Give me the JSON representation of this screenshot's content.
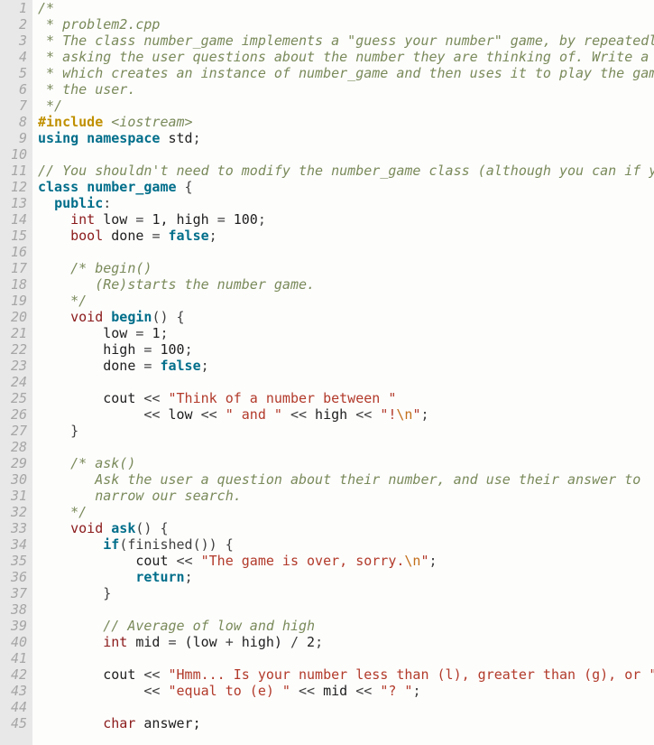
{
  "lines": [
    [
      {
        "t": "/*",
        "c": "c-comment"
      }
    ],
    [
      {
        "t": " * problem2.cpp",
        "c": "c-comment"
      }
    ],
    [
      {
        "t": " * The class number_game implements a \"guess your number\" game, by repeatedly",
        "c": "c-comment"
      }
    ],
    [
      {
        "t": " * asking the user questions about the number they are thinking of. Write a main",
        "c": "c-comment"
      }
    ],
    [
      {
        "t": " * which creates an instance of number_game and then uses it to play the game with",
        "c": "c-comment"
      }
    ],
    [
      {
        "t": " * the user.",
        "c": "c-comment"
      }
    ],
    [
      {
        "t": " */",
        "c": "c-comment"
      }
    ],
    [
      {
        "t": "#include ",
        "c": "c-pre"
      },
      {
        "t": "<iostream>",
        "c": "c-inc"
      }
    ],
    [
      {
        "t": "using namespace ",
        "c": "c-kw"
      },
      {
        "t": "std",
        "c": "c-id"
      },
      {
        "t": ";",
        "c": "c-op"
      }
    ],
    [],
    [
      {
        "t": "// You shouldn't need to modify the number_game class (although you can if you want).",
        "c": "c-comment"
      }
    ],
    [
      {
        "t": "class",
        "c": "c-kw"
      },
      {
        "t": " ",
        "c": ""
      },
      {
        "t": "number_game",
        "c": "c-kw"
      },
      {
        "t": " {",
        "c": "c-op"
      }
    ],
    [
      {
        "t": "  ",
        "c": ""
      },
      {
        "t": "public",
        "c": "c-kw"
      },
      {
        "t": ":",
        "c": "c-op"
      }
    ],
    [
      {
        "t": "    ",
        "c": ""
      },
      {
        "t": "int",
        "c": "c-type"
      },
      {
        "t": " low ",
        "c": "c-id"
      },
      {
        "t": "=",
        "c": "c-op"
      },
      {
        "t": " ",
        "c": ""
      },
      {
        "t": "1",
        "c": "c-num"
      },
      {
        "t": ", high ",
        "c": "c-id"
      },
      {
        "t": "=",
        "c": "c-op"
      },
      {
        "t": " ",
        "c": ""
      },
      {
        "t": "100",
        "c": "c-num"
      },
      {
        "t": ";",
        "c": "c-op"
      }
    ],
    [
      {
        "t": "    ",
        "c": ""
      },
      {
        "t": "bool",
        "c": "c-type"
      },
      {
        "t": " done ",
        "c": "c-id"
      },
      {
        "t": "=",
        "c": "c-op"
      },
      {
        "t": " ",
        "c": ""
      },
      {
        "t": "false",
        "c": "c-bool"
      },
      {
        "t": ";",
        "c": "c-op"
      }
    ],
    [],
    [
      {
        "t": "    ",
        "c": ""
      },
      {
        "t": "/* begin()",
        "c": "c-comment"
      }
    ],
    [
      {
        "t": "       (Re)starts the number game.",
        "c": "c-comment"
      }
    ],
    [
      {
        "t": "    */",
        "c": "c-comment"
      }
    ],
    [
      {
        "t": "    ",
        "c": ""
      },
      {
        "t": "void",
        "c": "c-type"
      },
      {
        "t": " ",
        "c": ""
      },
      {
        "t": "begin",
        "c": "c-kw"
      },
      {
        "t": "() {",
        "c": "c-op"
      }
    ],
    [
      {
        "t": "        low ",
        "c": "c-id"
      },
      {
        "t": "=",
        "c": "c-op"
      },
      {
        "t": " ",
        "c": ""
      },
      {
        "t": "1",
        "c": "c-num"
      },
      {
        "t": ";",
        "c": "c-op"
      }
    ],
    [
      {
        "t": "        high ",
        "c": "c-id"
      },
      {
        "t": "=",
        "c": "c-op"
      },
      {
        "t": " ",
        "c": ""
      },
      {
        "t": "100",
        "c": "c-num"
      },
      {
        "t": ";",
        "c": "c-op"
      }
    ],
    [
      {
        "t": "        done ",
        "c": "c-id"
      },
      {
        "t": "=",
        "c": "c-op"
      },
      {
        "t": " ",
        "c": ""
      },
      {
        "t": "false",
        "c": "c-bool"
      },
      {
        "t": ";",
        "c": "c-op"
      }
    ],
    [],
    [
      {
        "t": "        cout ",
        "c": "c-id"
      },
      {
        "t": "<<",
        "c": "c-op"
      },
      {
        "t": " ",
        "c": ""
      },
      {
        "t": "\"Think of a number between \"",
        "c": "c-str"
      }
    ],
    [
      {
        "t": "             ",
        "c": ""
      },
      {
        "t": "<<",
        "c": "c-op"
      },
      {
        "t": " low ",
        "c": "c-id"
      },
      {
        "t": "<<",
        "c": "c-op"
      },
      {
        "t": " ",
        "c": ""
      },
      {
        "t": "\" and \"",
        "c": "c-str"
      },
      {
        "t": " ",
        "c": ""
      },
      {
        "t": "<<",
        "c": "c-op"
      },
      {
        "t": " high ",
        "c": "c-id"
      },
      {
        "t": "<<",
        "c": "c-op"
      },
      {
        "t": " ",
        "c": ""
      },
      {
        "t": "\"!",
        "c": "c-str"
      },
      {
        "t": "\\n",
        "c": "c-esc"
      },
      {
        "t": "\"",
        "c": "c-str"
      },
      {
        "t": ";",
        "c": "c-op"
      }
    ],
    [
      {
        "t": "    }",
        "c": "c-op"
      }
    ],
    [],
    [
      {
        "t": "    ",
        "c": ""
      },
      {
        "t": "/* ask()",
        "c": "c-comment"
      }
    ],
    [
      {
        "t": "       Ask the user a question about their number, and use their answer to",
        "c": "c-comment"
      }
    ],
    [
      {
        "t": "       narrow our search.",
        "c": "c-comment"
      }
    ],
    [
      {
        "t": "    */",
        "c": "c-comment"
      }
    ],
    [
      {
        "t": "    ",
        "c": ""
      },
      {
        "t": "void",
        "c": "c-type"
      },
      {
        "t": " ",
        "c": ""
      },
      {
        "t": "ask",
        "c": "c-kw"
      },
      {
        "t": "() {",
        "c": "c-op"
      }
    ],
    [
      {
        "t": "        ",
        "c": ""
      },
      {
        "t": "if",
        "c": "c-kw"
      },
      {
        "t": "(finished()) {",
        "c": "c-op"
      }
    ],
    [
      {
        "t": "            cout ",
        "c": "c-id"
      },
      {
        "t": "<<",
        "c": "c-op"
      },
      {
        "t": " ",
        "c": ""
      },
      {
        "t": "\"The game is over, sorry.",
        "c": "c-str"
      },
      {
        "t": "\\n",
        "c": "c-esc"
      },
      {
        "t": "\"",
        "c": "c-str"
      },
      {
        "t": ";",
        "c": "c-op"
      }
    ],
    [
      {
        "t": "            ",
        "c": ""
      },
      {
        "t": "return",
        "c": "c-kw"
      },
      {
        "t": ";",
        "c": "c-op"
      }
    ],
    [
      {
        "t": "        }",
        "c": "c-op"
      }
    ],
    [],
    [
      {
        "t": "        ",
        "c": ""
      },
      {
        "t": "// Average of low and high",
        "c": "c-comment"
      }
    ],
    [
      {
        "t": "        ",
        "c": ""
      },
      {
        "t": "int",
        "c": "c-type"
      },
      {
        "t": " mid ",
        "c": "c-id"
      },
      {
        "t": "=",
        "c": "c-op"
      },
      {
        "t": " (low ",
        "c": "c-id"
      },
      {
        "t": "+",
        "c": "c-op"
      },
      {
        "t": " high) ",
        "c": "c-id"
      },
      {
        "t": "/",
        "c": "c-op"
      },
      {
        "t": " ",
        "c": ""
      },
      {
        "t": "2",
        "c": "c-num"
      },
      {
        "t": ";",
        "c": "c-op"
      }
    ],
    [],
    [
      {
        "t": "        cout ",
        "c": "c-id"
      },
      {
        "t": "<<",
        "c": "c-op"
      },
      {
        "t": " ",
        "c": ""
      },
      {
        "t": "\"Hmm... Is your number less than (l), greater than (g), or \"",
        "c": "c-str"
      }
    ],
    [
      {
        "t": "             ",
        "c": ""
      },
      {
        "t": "<<",
        "c": "c-op"
      },
      {
        "t": " ",
        "c": ""
      },
      {
        "t": "\"equal to (e) \"",
        "c": "c-str"
      },
      {
        "t": " ",
        "c": ""
      },
      {
        "t": "<<",
        "c": "c-op"
      },
      {
        "t": " mid ",
        "c": "c-id"
      },
      {
        "t": "<<",
        "c": "c-op"
      },
      {
        "t": " ",
        "c": ""
      },
      {
        "t": "\"? \"",
        "c": "c-str"
      },
      {
        "t": ";",
        "c": "c-op"
      }
    ],
    [],
    [
      {
        "t": "        ",
        "c": ""
      },
      {
        "t": "char",
        "c": "c-type"
      },
      {
        "t": " answer;",
        "c": "c-id"
      }
    ]
  ]
}
